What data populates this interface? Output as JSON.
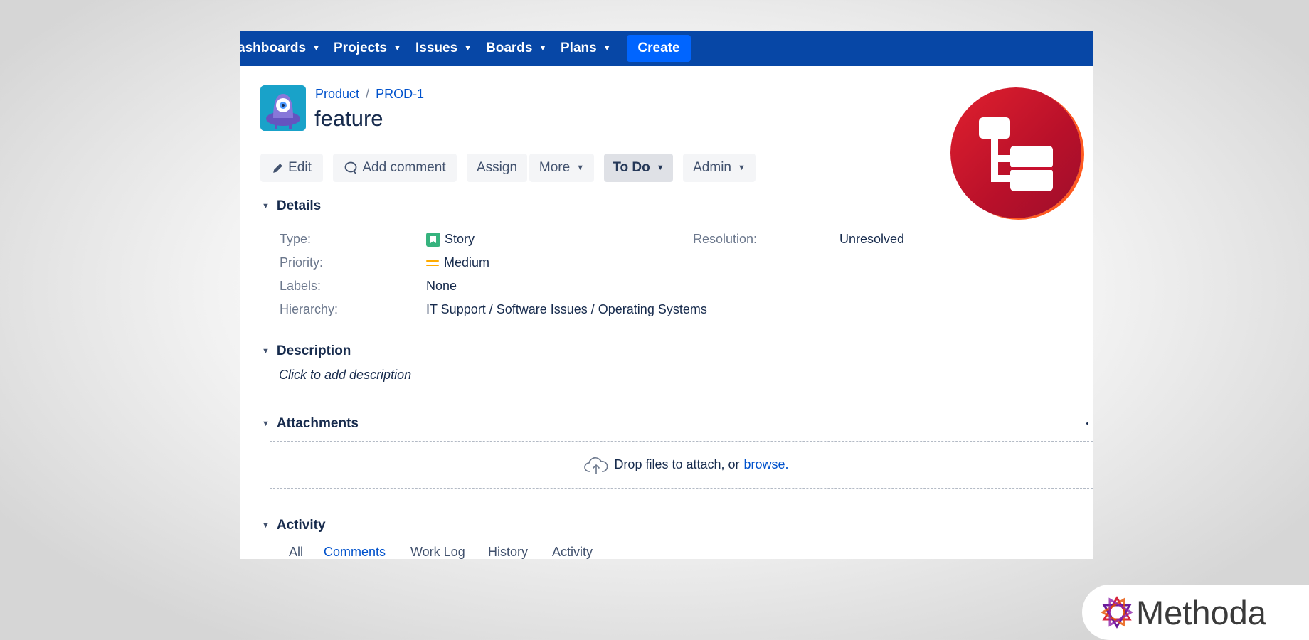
{
  "nav": {
    "items": [
      "ashboards",
      "Projects",
      "Issues",
      "Boards",
      "Plans"
    ],
    "create_label": "Create"
  },
  "issue": {
    "breadcrumb": {
      "project": "Product",
      "separator": "/",
      "key": "PROD-1"
    },
    "title": "feature"
  },
  "toolbar": {
    "edit": "Edit",
    "add_comment": "Add comment",
    "assign": "Assign",
    "more": "More",
    "status": "To Do",
    "admin": "Admin"
  },
  "details": {
    "heading": "Details",
    "type_label": "Type:",
    "type_value": "Story",
    "priority_label": "Priority:",
    "priority_value": "Medium",
    "labels_label": "Labels:",
    "labels_value": "None",
    "hierarchy_label": "Hierarchy:",
    "hierarchy_value": "IT Support / Software Issues / Operating Systems",
    "resolution_label": "Resolution:",
    "resolution_value": "Unresolved"
  },
  "description": {
    "heading": "Description",
    "placeholder": "Click to add description"
  },
  "attachments": {
    "heading": "Attachments",
    "drop_text": "Drop files to attach, or",
    "browse_link": "browse."
  },
  "activity": {
    "heading": "Activity",
    "tabs": [
      "All",
      "Comments",
      "Work Log",
      "History",
      "Activity"
    ],
    "active_tab": "Comments"
  },
  "branding": {
    "company": "Methoda"
  },
  "colors": {
    "nav_bg": "#0747a6",
    "create_bg": "#0065ff",
    "link": "#0052cc",
    "story_green": "#36b37e",
    "priority_medium": "#ffab00",
    "logo_red": "#c8102e"
  },
  "icons": [
    "pencil-icon",
    "comment-icon",
    "chevron-down-icon",
    "story-icon",
    "priority-medium-icon",
    "cloud-upload-icon",
    "hierarchy-logo-icon",
    "methoda-logo-icon"
  ]
}
